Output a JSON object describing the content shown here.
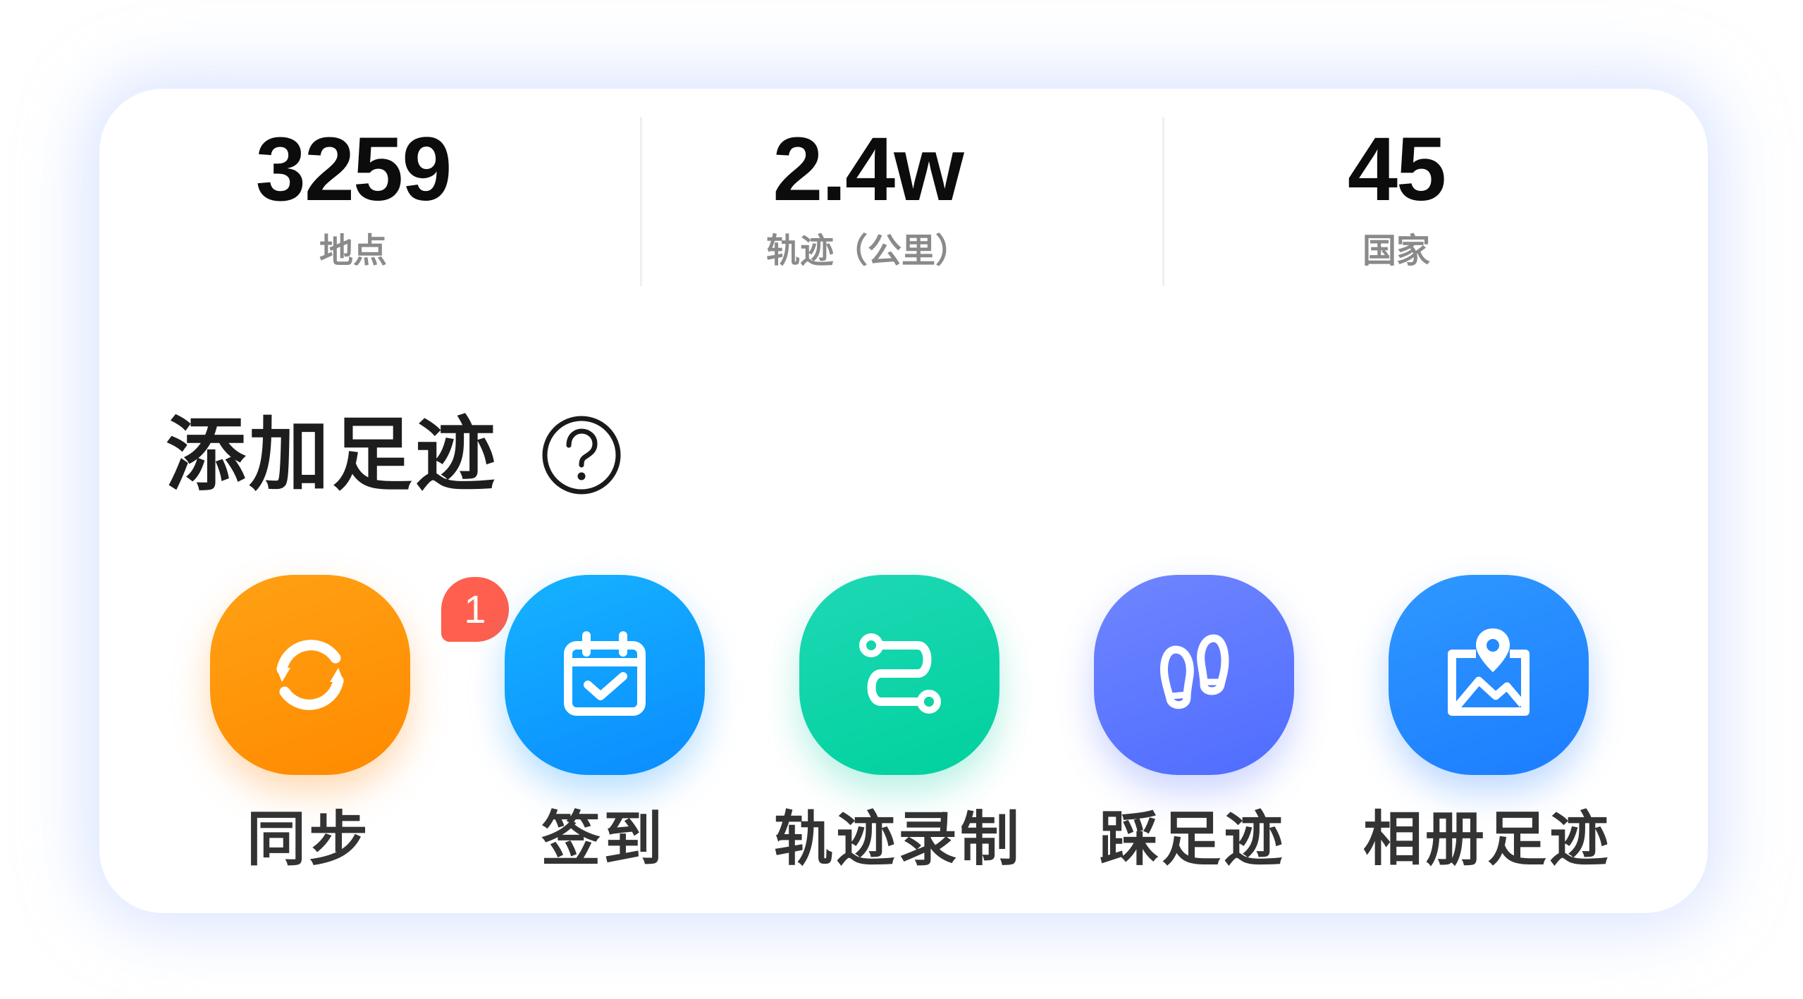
{
  "stats": [
    {
      "value": "3259",
      "label": "地点"
    },
    {
      "value": "2.4w",
      "label": "轨迹（公里）"
    },
    {
      "value": "45",
      "label": "国家"
    }
  ],
  "section": {
    "title": "添加足迹",
    "help_icon": "question-circle-icon"
  },
  "actions": [
    {
      "label": "同步",
      "icon": "sync-icon",
      "color": "#ff9200",
      "badge": "1"
    },
    {
      "label": "签到",
      "icon": "calendar-check-icon",
      "color": "#0a9dff"
    },
    {
      "label": "轨迹录制",
      "icon": "route-icon",
      "color": "#00d4a6"
    },
    {
      "label": "踩足迹",
      "icon": "footprints-icon",
      "color": "#5c78ff"
    },
    {
      "label": "相册足迹",
      "icon": "photo-location-icon",
      "color": "#2589ff"
    }
  ]
}
